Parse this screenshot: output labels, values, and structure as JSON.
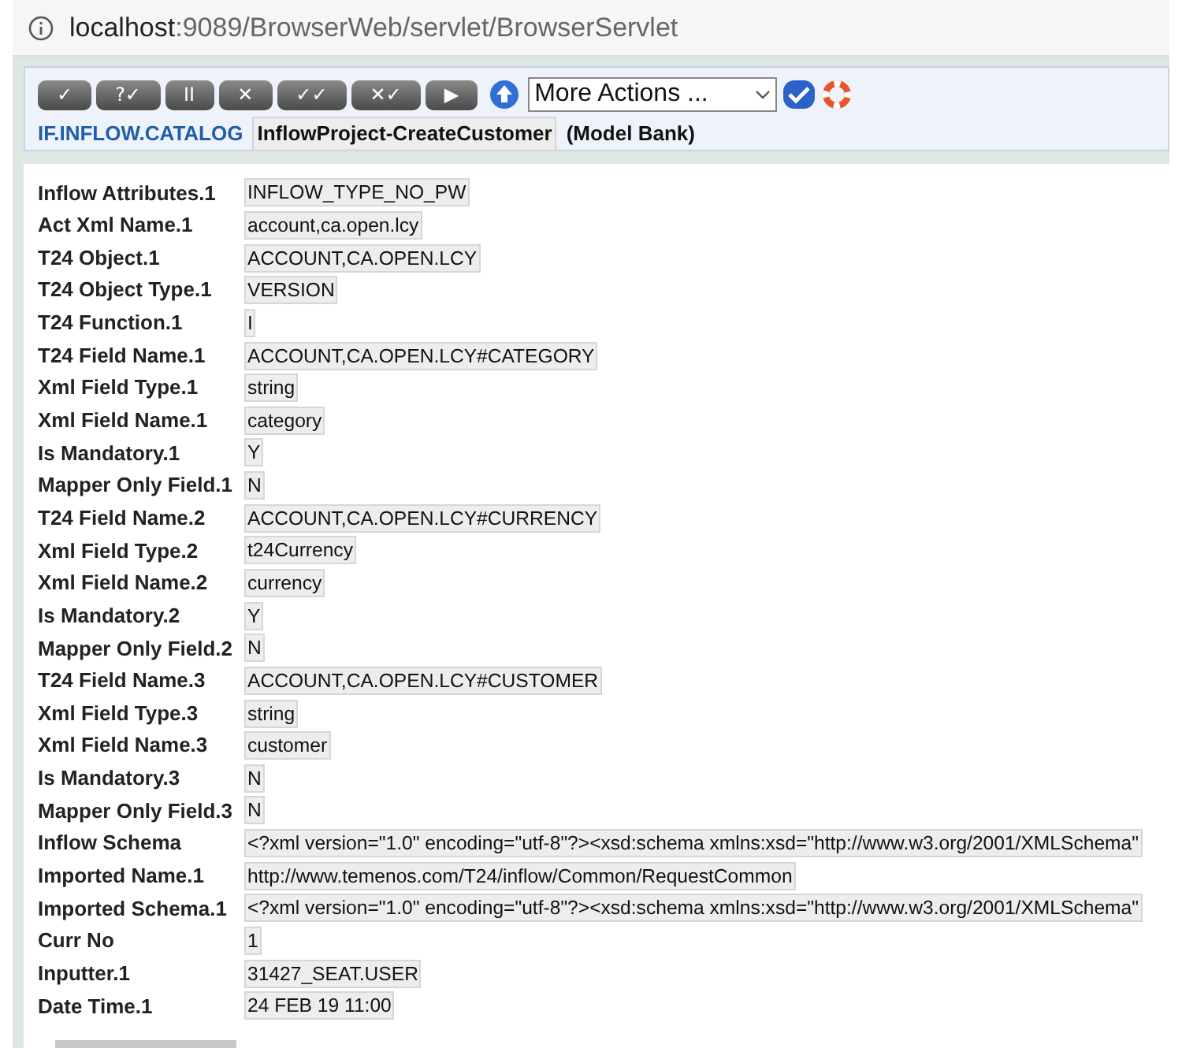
{
  "address_bar": {
    "host": "localhost",
    "path": ":9089/BrowserWeb/servlet/BrowserServlet"
  },
  "toolbar": {
    "buttons": [
      "✓",
      "?✓",
      "II",
      "✕",
      "✓✓",
      "✕✓",
      "▶"
    ],
    "actions_dropdown": {
      "value": "More Actions ..."
    }
  },
  "record": {
    "application": "IF.INFLOW.CATALOG",
    "id": "InflowProject-CreateCustomer",
    "company": "(Model Bank)"
  },
  "fields": [
    {
      "label": "Inflow Attributes.1",
      "value": "INFLOW_TYPE_NO_PW"
    },
    {
      "label": "Act Xml Name.1",
      "value": "account,ca.open.lcy"
    },
    {
      "label": "T24 Object.1",
      "value": "ACCOUNT,CA.OPEN.LCY"
    },
    {
      "label": "T24 Object Type.1",
      "value": "VERSION"
    },
    {
      "label": "T24 Function.1",
      "value": "I"
    },
    {
      "label": "T24 Field Name.1",
      "value": "ACCOUNT,CA.OPEN.LCY#CATEGORY"
    },
    {
      "label": "Xml Field Type.1",
      "value": "string"
    },
    {
      "label": "Xml Field Name.1",
      "value": "category"
    },
    {
      "label": "Is Mandatory.1",
      "value": "Y"
    },
    {
      "label": "Mapper Only Field.1",
      "value": "N"
    },
    {
      "label": "T24 Field Name.2",
      "value": "ACCOUNT,CA.OPEN.LCY#CURRENCY"
    },
    {
      "label": "Xml Field Type.2",
      "value": "t24Currency"
    },
    {
      "label": "Xml Field Name.2",
      "value": "currency"
    },
    {
      "label": "Is Mandatory.2",
      "value": "Y"
    },
    {
      "label": "Mapper Only Field.2",
      "value": "N"
    },
    {
      "label": "T24 Field Name.3",
      "value": "ACCOUNT,CA.OPEN.LCY#CUSTOMER"
    },
    {
      "label": "Xml Field Type.3",
      "value": "string"
    },
    {
      "label": "Xml Field Name.3",
      "value": "customer"
    },
    {
      "label": "Is Mandatory.3",
      "value": "N"
    },
    {
      "label": "Mapper Only Field.3",
      "value": "N"
    },
    {
      "label": "Inflow Schema",
      "value": "<?xml version=\"1.0\" encoding=\"utf-8\"?><xsd:schema xmlns:xsd=\"http://www.w3.org/2001/XMLSchema\""
    },
    {
      "label": "Imported Name.1",
      "value": "http://www.temenos.com/T24/inflow/Common/RequestCommon"
    },
    {
      "label": "Imported Schema.1",
      "value": "<?xml version=\"1.0\" encoding=\"utf-8\"?><xsd:schema xmlns:xsd=\"http://www.w3.org/2001/XMLSchema\""
    },
    {
      "label": "Curr No",
      "value": "1"
    },
    {
      "label": "Inputter.1",
      "value": "31427_SEAT.USER"
    },
    {
      "label": "Date Time.1",
      "value": "24 FEB 19 11:00"
    }
  ]
}
